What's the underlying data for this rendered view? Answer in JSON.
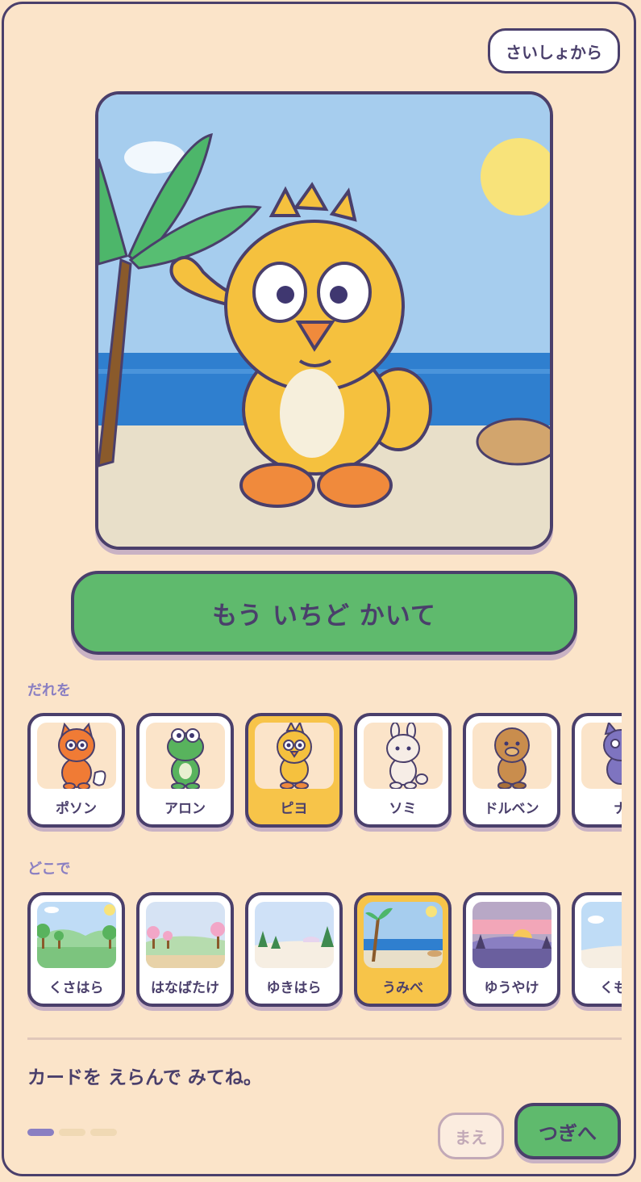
{
  "header": {
    "restart_label": "さいしょから"
  },
  "scene": {
    "character": "ピヨ",
    "place": "うみべ"
  },
  "actions": {
    "draw_again_label": "もう いちど かいて"
  },
  "who_section": {
    "label": "だれを",
    "selected": "ピヨ",
    "cards": [
      {
        "name": "ポソン",
        "icon": "fox-icon",
        "color": "#f07b35"
      },
      {
        "name": "アロン",
        "icon": "frog-icon",
        "color": "#58b35d"
      },
      {
        "name": "ピヨ",
        "icon": "chick-icon",
        "color": "#f5c13e"
      },
      {
        "name": "ソミ",
        "icon": "bunny-icon",
        "color": "#f6ede6"
      },
      {
        "name": "ドルベン",
        "icon": "bear-icon",
        "color": "#c98d4d"
      },
      {
        "name": "ナ",
        "icon": "cat-icon",
        "color": "#7e74c0"
      }
    ]
  },
  "where_section": {
    "label": "どこで",
    "selected": "うみべ",
    "cards": [
      {
        "name": "くさはら",
        "icon": "meadow-icon"
      },
      {
        "name": "はなばたけ",
        "icon": "flower-field-icon"
      },
      {
        "name": "ゆきはら",
        "icon": "snowfield-icon"
      },
      {
        "name": "うみべ",
        "icon": "beach-icon"
      },
      {
        "name": "ゆうやけ",
        "icon": "sunset-icon"
      },
      {
        "name": "くもの",
        "icon": "clouds-icon"
      }
    ]
  },
  "footer": {
    "hint": "カードを えらんで みてね。",
    "step_current": 1,
    "step_total": 3,
    "prev_label": "まえ",
    "next_label": "つぎへ"
  }
}
